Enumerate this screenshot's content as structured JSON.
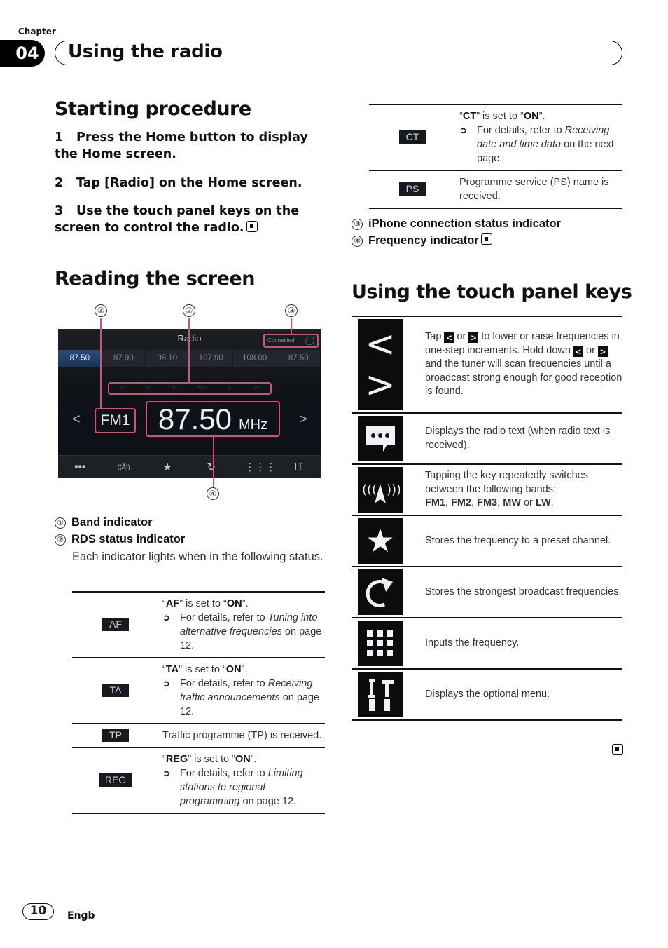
{
  "chapter": {
    "label": "Chapter",
    "number": "04",
    "title": "Using the radio"
  },
  "starting_procedure": {
    "heading": "Starting procedure",
    "steps": [
      {
        "num": "1",
        "text": "Press the Home button to display the Home screen."
      },
      {
        "num": "2",
        "text": "Tap [Radio] on the Home screen."
      },
      {
        "num": "3",
        "text": "Use the touch panel keys on the screen to control the radio."
      }
    ]
  },
  "reading_screen": {
    "heading": "Reading the screen",
    "callouts": [
      "①",
      "②",
      "③",
      "④"
    ],
    "screen": {
      "title": "Radio",
      "presets": [
        "87.50",
        "87.90",
        "98.10",
        "107.90",
        "108.00",
        "87.50"
      ],
      "active_preset": 0,
      "connection_status": "Connected",
      "rds_indicators": [
        "AF",
        "TA",
        "TP",
        "REG",
        "CT",
        "PS"
      ],
      "band": "FM1",
      "frequency": "87.50",
      "unit": "MHz",
      "prev_glyph": "<",
      "next_glyph": ">",
      "toolbar_icons": [
        {
          "name": "radio-text-icon",
          "glyph": "▪▪▪"
        },
        {
          "name": "band-icon",
          "glyph": "((Å))"
        },
        {
          "name": "star-icon",
          "glyph": "★"
        },
        {
          "name": "refresh-icon",
          "glyph": "↻"
        },
        {
          "name": "keypad-icon",
          "glyph": "⋮⋮⋮"
        },
        {
          "name": "menu-icon",
          "glyph": "IT"
        }
      ]
    },
    "items": [
      {
        "num": "①",
        "label": "Band indicator"
      },
      {
        "num": "②",
        "label": "RDS status indicator",
        "desc": "Each indicator lights when in the following status."
      }
    ]
  },
  "rds_table_left": [
    {
      "badge": "AF",
      "title_pre": "“",
      "bold": "AF",
      "title_mid": "” is set to “",
      "bold2": "ON",
      "title_post": "”.",
      "bullet_pre": "For details, refer to ",
      "bullet_italic": "Tuning into alternative frequencies",
      "bullet_post": " on page 12."
    },
    {
      "badge": "TA",
      "title_pre": "“",
      "bold": "TA",
      "title_mid": "” is set to “",
      "bold2": "ON",
      "title_post": "”.",
      "bullet_pre": "For details, refer to ",
      "bullet_italic": "Receiving traffic announcements",
      "bullet_post": " on page 12."
    },
    {
      "badge": "TP",
      "text": "Traffic programme (TP) is received."
    },
    {
      "badge": "REG",
      "title_pre": "“",
      "bold": "REG",
      "title_mid": "” is set to “",
      "bold2": "ON",
      "title_post": "”.",
      "bullet_pre": "For details, refer to ",
      "bullet_italic": "Limiting stations to regional programming",
      "bullet_post": " on page 12."
    }
  ],
  "rds_table_right": [
    {
      "badge": "CT",
      "title_pre": "“",
      "bold": "CT",
      "title_mid": "” is set to “",
      "bold2": "ON",
      "title_post": "”.",
      "bullet_pre": "For details, refer to ",
      "bullet_italic": "Receiving date and time data",
      "bullet_post": " on the next page."
    },
    {
      "badge": "PS",
      "text": "Programme service (PS) name is received."
    }
  ],
  "more_items": [
    {
      "num": "③",
      "label": "iPhone connection status indicator"
    },
    {
      "num": "④",
      "label": "Frequency indicator"
    }
  ],
  "touch_keys": {
    "heading": "Using the touch panel keys",
    "rows": [
      {
        "icon": "prev-next-icon",
        "t1": "Tap ",
        "g1": "<",
        "t2": " or ",
        "g2": ">",
        "t3": " to lower or raise frequencies in one-step increments. Hold down ",
        "g3": "<",
        "t4": " or ",
        "g4": ">",
        "t5": " and the tuner will scan frequencies until a broadcast strong enough for good reception is found."
      },
      {
        "icon": "radio-text-icon",
        "text": "Displays the radio text (when radio text is received)."
      },
      {
        "icon": "band-icon",
        "text": "Tapping the key repeatedly switches between the following bands:",
        "bands": [
          "FM1",
          "FM2",
          "FM3",
          "MW",
          "LW"
        ],
        "sep": ", ",
        "or": " or "
      },
      {
        "icon": "star-icon",
        "text": "Stores the frequency to a preset channel."
      },
      {
        "icon": "refresh-icon",
        "text": "Stores the strongest broadcast frequencies."
      },
      {
        "icon": "keypad-icon",
        "text": "Inputs the frequency."
      },
      {
        "icon": "tools-icon",
        "text": "Displays the optional menu."
      }
    ]
  },
  "footer": {
    "page": "10",
    "lang": "Engb"
  }
}
